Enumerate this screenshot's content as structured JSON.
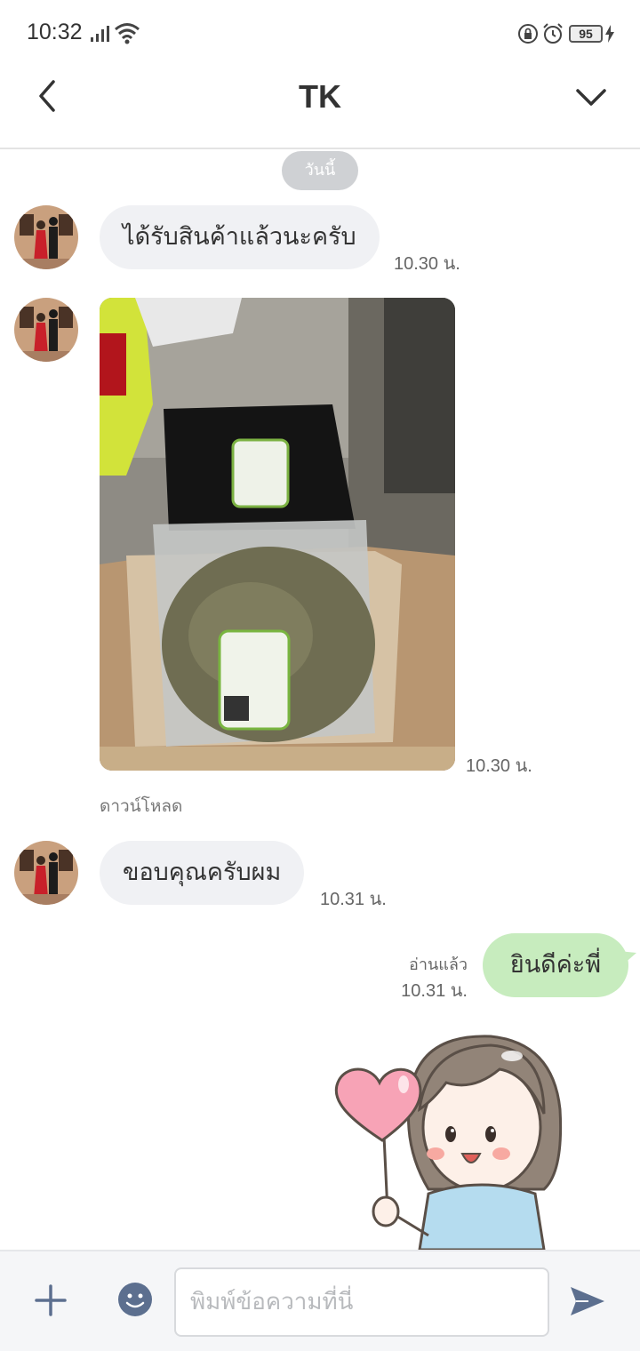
{
  "status_bar": {
    "time": "10:32",
    "battery": "95",
    "icons": [
      "signal-icon",
      "wifi-icon",
      "lock-icon",
      "alarm-icon",
      "charge-icon"
    ]
  },
  "header": {
    "title": "TK",
    "icons": [
      "back-icon",
      "chevron-down-icon"
    ]
  },
  "chat": {
    "date_label": "วันนี้",
    "messages": [
      {
        "type": "text",
        "from": "other",
        "text": "ได้รับสินค้าแล้วนะครับ",
        "time": "10.30 น."
      },
      {
        "type": "image",
        "from": "other",
        "time": "10.30 น.",
        "download_label": "ดาวน์โหลด"
      },
      {
        "type": "text",
        "from": "other",
        "text": "ขอบคุณครับผม",
        "time": "10.31 น."
      },
      {
        "type": "text",
        "from": "me",
        "text": "ยินดีค่ะพี่",
        "read_label": "อ่านแล้ว",
        "time": "10.31 น."
      },
      {
        "type": "sticker",
        "from": "me",
        "sticker": "girl-holding-heart-balloon"
      }
    ]
  },
  "input_bar": {
    "placeholder": "พิมพ์ข้อความที่นี่",
    "icons": [
      "plus-icon",
      "emoji-icon",
      "send-icon"
    ]
  },
  "colors": {
    "incoming_bubble": "#f0f1f4",
    "outgoing_bubble": "#c7ecbe",
    "date_pill": "#cfd1d4",
    "send_icon": "#5c6f8f"
  }
}
